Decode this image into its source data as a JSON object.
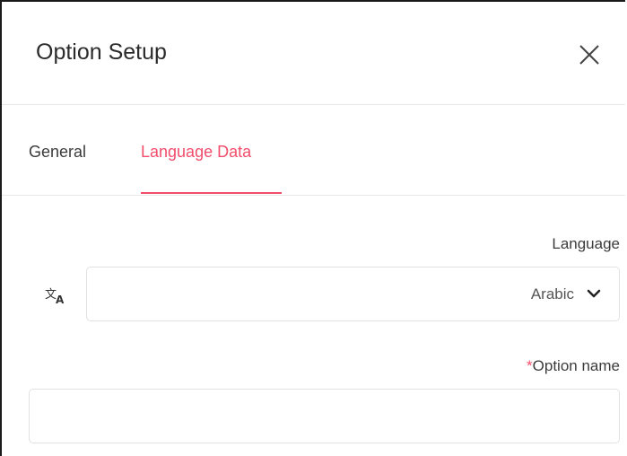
{
  "dialog": {
    "title": "Option Setup",
    "close_icon": "close-icon"
  },
  "tabs": [
    {
      "label": "General",
      "active": false
    },
    {
      "label": "Language Data",
      "active": true
    }
  ],
  "form": {
    "language": {
      "label": "Language",
      "icon": "translate-icon",
      "selected": "Arabic",
      "chevron_icon": "chevron-down-icon"
    },
    "option_name": {
      "required_mark": "*",
      "label": "Option name",
      "value": "",
      "placeholder": ""
    }
  },
  "colors": {
    "accent": "#f24d6b",
    "border": "#e2e2e2",
    "text": "#3b3b3b"
  }
}
